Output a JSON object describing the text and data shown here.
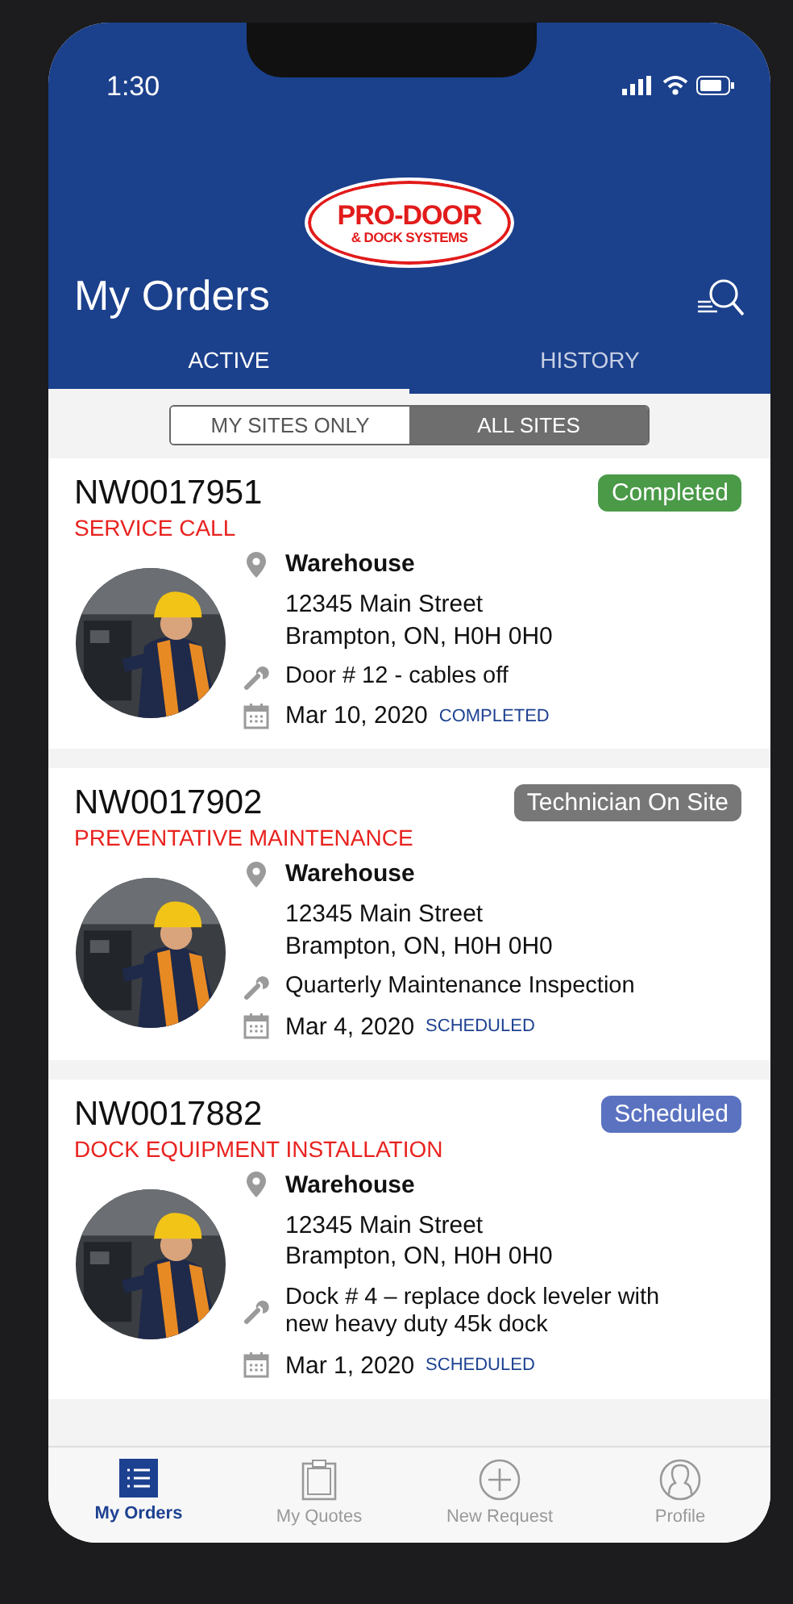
{
  "status_bar": {
    "time": "1:30"
  },
  "logo": {
    "line_1": "PRO-DOOR",
    "line_2": "& DOCK SYSTEMS"
  },
  "header": {
    "title": "My Orders"
  },
  "tabs": [
    {
      "label": "ACTIVE",
      "selected": true
    },
    {
      "label": "HISTORY",
      "selected": false
    }
  ],
  "site_filter": [
    {
      "label": "MY SITES ONLY",
      "selected": false
    },
    {
      "label": "ALL SITES",
      "selected": true
    }
  ],
  "orders": [
    {
      "number": "NW0017951",
      "type": "SERVICE CALL",
      "status": "Completed",
      "color": "#4a9a48",
      "site": "Warehouse",
      "address_1": "12345 Main Street",
      "address_2": "Brampton,  ON, H0H 0H0",
      "description": "Door # 12 - cables off",
      "date": "Mar 10, 2020",
      "date_status": "COMPLETED"
    },
    {
      "number": "NW0017902",
      "type": "PREVENTATIVE MAINTENANCE",
      "status": "Technician On Site",
      "color": "#777777",
      "site": "Warehouse",
      "address_1": "12345 Main Street",
      "address_2": "Brampton,  ON, H0H 0H0",
      "description": "Quarterly Maintenance Inspection",
      "date": "Mar 4, 2020",
      "date_status": "SCHEDULED"
    },
    {
      "number": "NW0017882",
      "type": "DOCK EQUIPMENT INSTALLATION",
      "status": "Scheduled",
      "color": "#5a72c0",
      "site": "Warehouse",
      "address_1": "12345 Main Street",
      "address_2": "Brampton,  ON, H0H 0H0",
      "description": "Dock # 4 – replace dock leveler with new heavy duty 45k dock",
      "date": "Mar 1, 2020",
      "date_status": "SCHEDULED"
    }
  ],
  "tab_bar": [
    {
      "label": "My Orders",
      "kind": "list",
      "selected": true
    },
    {
      "label": "My Quotes",
      "kind": "clipboard",
      "selected": false
    },
    {
      "label": "New Request",
      "kind": "plus",
      "selected": false
    },
    {
      "label": "Profile",
      "kind": "person",
      "selected": false
    }
  ]
}
